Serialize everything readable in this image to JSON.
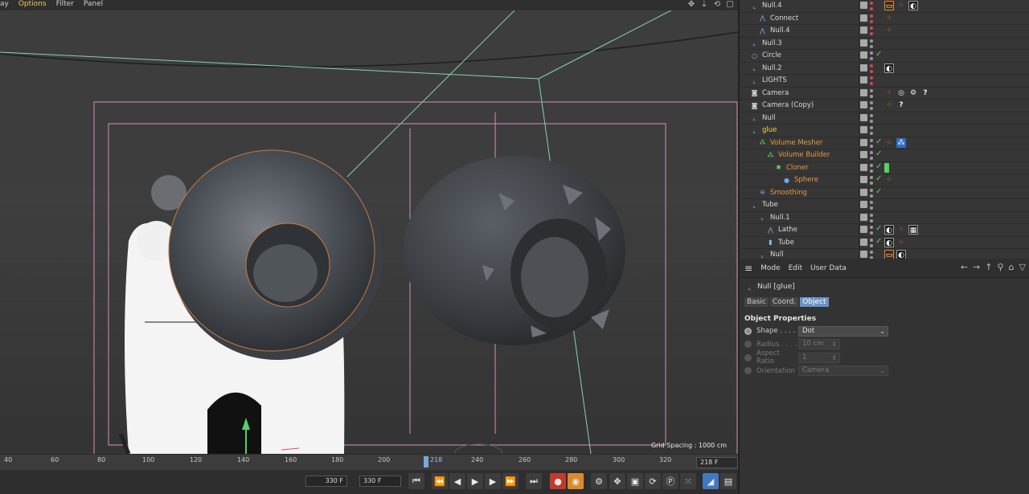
{
  "viewport": {
    "menu": [
      "ay",
      "Options",
      "Filter",
      "Panel"
    ],
    "active_menu": "Options",
    "grid_spacing": "Grid Spacing : 1000 cm"
  },
  "timeline": {
    "ticks": [
      "40",
      "60",
      "80",
      "100",
      "120",
      "140",
      "160",
      "180",
      "200",
      "218",
      "240",
      "260",
      "280",
      "300",
      "320"
    ],
    "current_frame": "218",
    "frame_field": "218 F"
  },
  "transport": {
    "end_field_a": "330 F",
    "end_field_b": "330 F"
  },
  "objects": [
    {
      "name": "Null.4",
      "indent": 1,
      "icon": "null-icon",
      "color": "normal",
      "tags": [
        "orange-tag",
        "dots-tag",
        "dark-tag"
      ],
      "check": false
    },
    {
      "name": "Connect",
      "indent": 2,
      "icon": "connect-icon",
      "color": "normal",
      "tags": [
        "dots-tag"
      ],
      "check": false
    },
    {
      "name": "Null.4",
      "indent": 2,
      "icon": "connect-icon",
      "color": "normal",
      "tags": [
        "dots-tag"
      ],
      "check": false
    },
    {
      "name": "Null.3",
      "indent": 1,
      "icon": "null-icon",
      "color": "normal",
      "tags": [],
      "check": false
    },
    {
      "name": "Circle",
      "indent": 1,
      "icon": "circle-icon",
      "color": "normal",
      "tags": [],
      "check": true
    },
    {
      "name": "Null.2",
      "indent": 1,
      "icon": "null-icon",
      "color": "normal",
      "tags": [
        "dark-tag"
      ],
      "check": false
    },
    {
      "name": "LIGHTS",
      "indent": 1,
      "icon": "null-icon",
      "color": "normal",
      "tags": [],
      "check": false
    },
    {
      "name": "Camera",
      "indent": 1,
      "icon": "camera-icon",
      "color": "normal",
      "tags": [
        "dots-tag",
        "target-tag",
        "gear-tag",
        "question-tag"
      ],
      "check": false
    },
    {
      "name": "Camera (Copy)",
      "indent": 1,
      "icon": "camera-icon",
      "color": "normal",
      "tags": [
        "dots-tag",
        "question-tag"
      ],
      "check": false
    },
    {
      "name": "Null",
      "indent": 1,
      "icon": "null-icon",
      "color": "normal",
      "tags": [],
      "check": false
    },
    {
      "name": "glue",
      "indent": 1,
      "icon": "null-icon",
      "color": "yellow",
      "tags": [],
      "check": false
    },
    {
      "name": "Volume Mesher",
      "indent": 2,
      "icon": "volume-icon",
      "color": "orange",
      "tags": [
        "dots-tag",
        "blue-tag"
      ],
      "check": true
    },
    {
      "name": "Volume Builder",
      "indent": 3,
      "icon": "volume-icon",
      "color": "orange",
      "tags": [],
      "check": true
    },
    {
      "name": "Cloner",
      "indent": 4,
      "icon": "cloner-icon",
      "color": "orange",
      "tags": [
        "green-tag"
      ],
      "check": true
    },
    {
      "name": "Sphere",
      "indent": 5,
      "icon": "sphere-icon",
      "color": "orange",
      "tags": [
        "dots-tag"
      ],
      "check": true
    },
    {
      "name": "Smoothing",
      "indent": 2,
      "icon": "smoothing-icon",
      "color": "orange",
      "tags": [],
      "check": true
    },
    {
      "name": "Tube",
      "indent": 1,
      "icon": "null-icon",
      "color": "normal",
      "tags": [],
      "check": false
    },
    {
      "name": "Null.1",
      "indent": 2,
      "icon": "null-icon",
      "color": "normal",
      "tags": [],
      "check": false
    },
    {
      "name": "Lathe",
      "indent": 3,
      "icon": "connect-icon",
      "color": "normal",
      "tags": [
        "dark-tag",
        "dots-tag",
        "check-tag"
      ],
      "check": true
    },
    {
      "name": "Tube",
      "indent": 3,
      "icon": "tube-icon",
      "color": "normal",
      "tags": [
        "dark-tag",
        "dots-tag"
      ],
      "check": true
    },
    {
      "name": "Null",
      "indent": 2,
      "icon": "null-icon",
      "color": "normal",
      "tags": [
        "orange-tag",
        "dark-tag"
      ],
      "check": false
    }
  ],
  "attributes": {
    "menu": [
      "Mode",
      "Edit",
      "User Data"
    ],
    "title": "Null [glue]",
    "tabs": [
      "Basic",
      "Coord.",
      "Object"
    ],
    "selected_tab": "Object",
    "section": "Object Properties",
    "shape_label": "Shape . . . .",
    "shape_value": "Dot",
    "radius_label": "Radius . . . .",
    "radius_value": "10 cm",
    "aspect_label": "Aspect Ratio",
    "aspect_value": "1",
    "orientation_label": "Orientation",
    "orientation_value": "Camera"
  }
}
